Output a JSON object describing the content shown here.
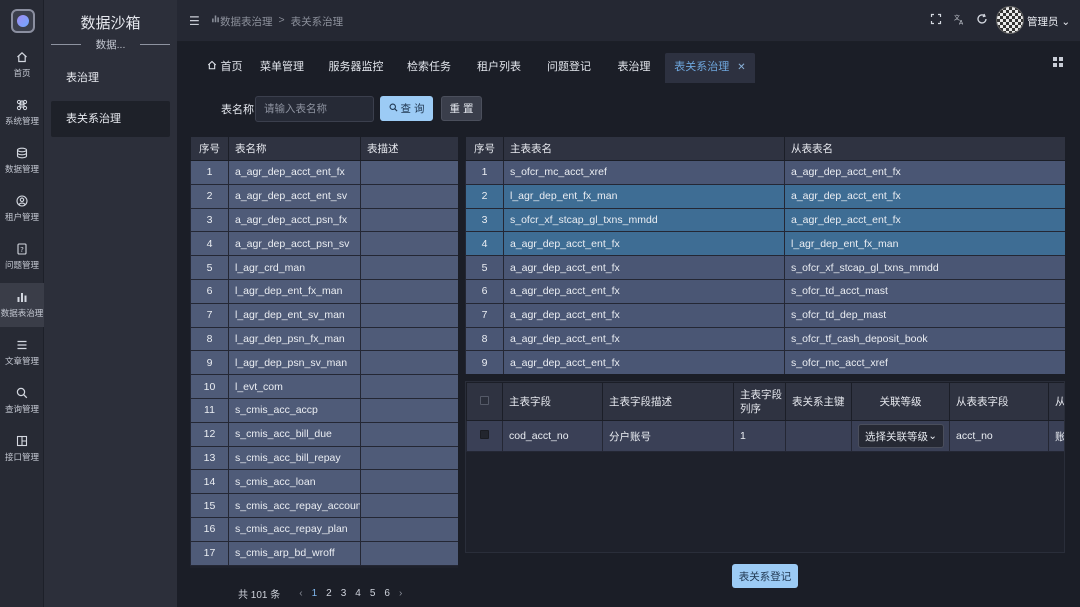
{
  "app": {
    "title": "数据沙箱",
    "subtitle": "数据..."
  },
  "iconbar": [
    {
      "label": "首页",
      "icon": "home-icon"
    },
    {
      "label": "系统管理",
      "icon": "command-icon"
    },
    {
      "label": "数据管理",
      "icon": "database-icon"
    },
    {
      "label": "租户管理",
      "icon": "user-circle-icon"
    },
    {
      "label": "问题管理",
      "icon": "question-doc-icon"
    },
    {
      "label": "数据表治理",
      "icon": "bar-chart-icon"
    },
    {
      "label": "文章管理",
      "icon": "list-icon"
    },
    {
      "label": "查询管理",
      "icon": "search-icon"
    },
    {
      "label": "接口管理",
      "icon": "layout-icon"
    }
  ],
  "sidebar": {
    "items": [
      {
        "label": "表治理"
      },
      {
        "label": "表关系治理"
      }
    ]
  },
  "header": {
    "breadcrumb_parent": "数据表治理",
    "breadcrumb_sep": ">",
    "breadcrumb_current": "表关系治理",
    "username": "管理员"
  },
  "tabs": [
    {
      "label": "首页"
    },
    {
      "label": "菜单管理"
    },
    {
      "label": "服务器监控"
    },
    {
      "label": "检索任务"
    },
    {
      "label": "租户列表"
    },
    {
      "label": "问题登记"
    },
    {
      "label": "表治理"
    },
    {
      "label": "表关系治理"
    }
  ],
  "search": {
    "label": "表名称",
    "placeholder": "请输入表名称",
    "query_label": "查 询",
    "reset_label": "重 置"
  },
  "left_table": {
    "headers": [
      "序号",
      "表名称",
      "表描述"
    ],
    "rows": [
      [
        "1",
        "a_agr_dep_acct_ent_fx",
        ""
      ],
      [
        "2",
        "a_agr_dep_acct_ent_sv",
        ""
      ],
      [
        "3",
        "a_agr_dep_acct_psn_fx",
        ""
      ],
      [
        "4",
        "a_agr_dep_acct_psn_sv",
        ""
      ],
      [
        "5",
        "l_agr_crd_man",
        ""
      ],
      [
        "6",
        "l_agr_dep_ent_fx_man",
        ""
      ],
      [
        "7",
        "l_agr_dep_ent_sv_man",
        ""
      ],
      [
        "8",
        "l_agr_dep_psn_fx_man",
        ""
      ],
      [
        "9",
        "l_agr_dep_psn_sv_man",
        ""
      ],
      [
        "10",
        "l_evt_com",
        ""
      ],
      [
        "11",
        "s_cmis_acc_accp",
        ""
      ],
      [
        "12",
        "s_cmis_acc_bill_due",
        ""
      ],
      [
        "13",
        "s_cmis_acc_bill_repay",
        ""
      ],
      [
        "14",
        "s_cmis_acc_loan",
        ""
      ],
      [
        "15",
        "s_cmis_acc_repay_account",
        ""
      ],
      [
        "16",
        "s_cmis_acc_repay_plan",
        ""
      ],
      [
        "17",
        "s_cmis_arp_bd_wroff",
        ""
      ]
    ]
  },
  "right_table": {
    "headers": [
      "序号",
      "主表表名",
      "从表表名"
    ],
    "rows": [
      [
        "1",
        "s_ofcr_mc_acct_xref",
        "a_agr_dep_acct_ent_fx"
      ],
      [
        "2",
        "l_agr_dep_ent_fx_man",
        "a_agr_dep_acct_ent_fx"
      ],
      [
        "3",
        "s_ofcr_xf_stcap_gl_txns_mmdd",
        "a_agr_dep_acct_ent_fx"
      ],
      [
        "4",
        "a_agr_dep_acct_ent_fx",
        "l_agr_dep_ent_fx_man"
      ],
      [
        "5",
        "a_agr_dep_acct_ent_fx",
        "s_ofcr_xf_stcap_gl_txns_mmdd"
      ],
      [
        "6",
        "a_agr_dep_acct_ent_fx",
        "s_ofcr_td_acct_mast"
      ],
      [
        "7",
        "a_agr_dep_acct_ent_fx",
        "s_ofcr_td_dep_mast"
      ],
      [
        "8",
        "a_agr_dep_acct_ent_fx",
        "s_ofcr_tf_cash_deposit_book"
      ],
      [
        "9",
        "a_agr_dep_acct_ent_fx",
        "s_ofcr_mc_acct_xref"
      ]
    ]
  },
  "field_table": {
    "headers": [
      "主表字段",
      "主表字段描述",
      "主表字段列序",
      "表关系主键",
      "关联等级",
      "从表表字段",
      "从表"
    ],
    "row": {
      "field": "cod_acct_no",
      "desc": "分户账号",
      "order": "1",
      "pk": "",
      "select_label": "选择关联等级",
      "slave_field": "acct_no",
      "slave_desc": "账号"
    }
  },
  "pager": {
    "total": "共 101 条",
    "pages": [
      "1",
      "2",
      "3",
      "4",
      "5",
      "6"
    ]
  },
  "register_button": "表关系登记"
}
